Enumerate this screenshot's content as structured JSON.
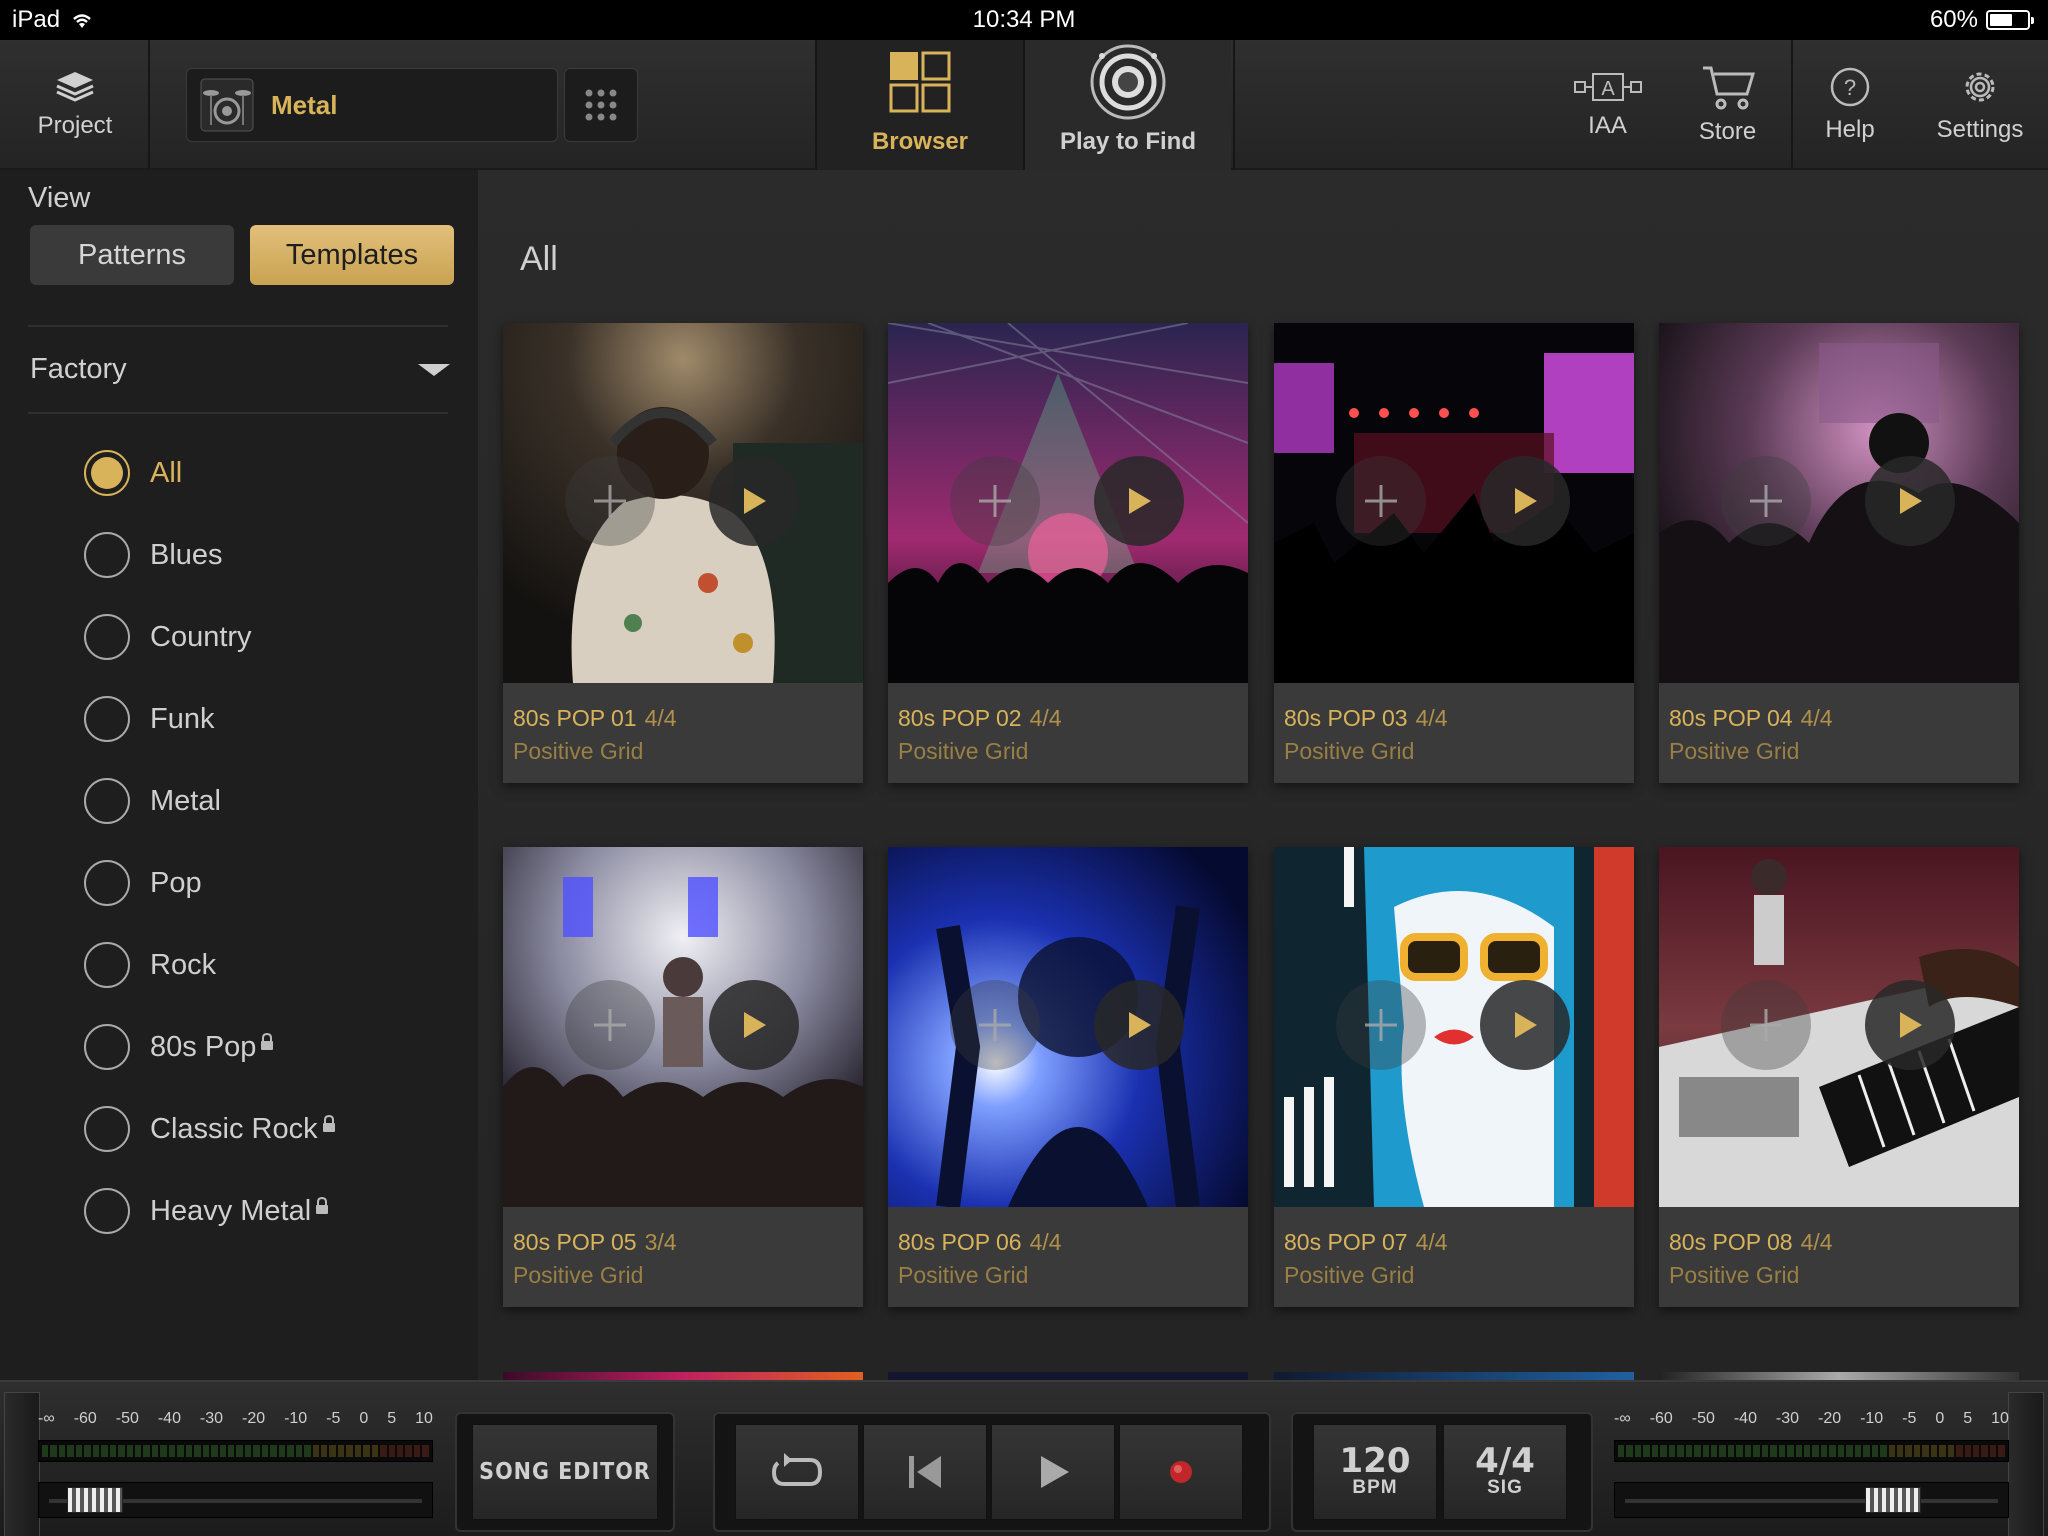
{
  "status": {
    "device": "iPad",
    "time": "10:34 PM",
    "battery": "60%",
    "battery_level": 0.6
  },
  "toolbar": {
    "project_label": "Project",
    "kit_name": "Metal",
    "browser_label": "Browser",
    "play_to_find_label": "Play to Find",
    "iaa_label": "IAA",
    "store_label": "Store",
    "help_label": "Help",
    "settings_label": "Settings"
  },
  "sidebar": {
    "view_label": "View",
    "patterns_label": "Patterns",
    "templates_label": "Templates",
    "factory_label": "Factory",
    "genres": [
      {
        "label": "All",
        "selected": true,
        "locked": false
      },
      {
        "label": "Blues",
        "selected": false,
        "locked": false
      },
      {
        "label": "Country",
        "selected": false,
        "locked": false
      },
      {
        "label": "Funk",
        "selected": false,
        "locked": false
      },
      {
        "label": "Metal",
        "selected": false,
        "locked": false
      },
      {
        "label": "Pop",
        "selected": false,
        "locked": false
      },
      {
        "label": "Rock",
        "selected": false,
        "locked": false
      },
      {
        "label": "80s Pop",
        "selected": false,
        "locked": true
      },
      {
        "label": "Classic Rock",
        "selected": false,
        "locked": true
      },
      {
        "label": "Heavy Metal",
        "selected": false,
        "locked": true
      }
    ]
  },
  "main": {
    "title": "All",
    "cards": [
      {
        "title": "80s POP 01",
        "sig": "4/4",
        "author": "Positive Grid"
      },
      {
        "title": "80s POP 02",
        "sig": "4/4",
        "author": "Positive Grid"
      },
      {
        "title": "80s POP 03",
        "sig": "4/4",
        "author": "Positive Grid"
      },
      {
        "title": "80s POP 04",
        "sig": "4/4",
        "author": "Positive Grid"
      },
      {
        "title": "80s POP 05",
        "sig": "3/4",
        "author": "Positive Grid"
      },
      {
        "title": "80s POP 06",
        "sig": "4/4",
        "author": "Positive Grid"
      },
      {
        "title": "80s POP 07",
        "sig": "4/4",
        "author": "Positive Grid"
      },
      {
        "title": "80s POP 08",
        "sig": "4/4",
        "author": "Positive Grid"
      }
    ]
  },
  "bottom": {
    "meter_scale": [
      "-∞",
      "-60",
      "-50",
      "-40",
      "-30",
      "-20",
      "-10",
      "-5",
      "0",
      "5",
      "10"
    ],
    "song_editor_label": "SONG EDITOR",
    "bpm_value": "120",
    "bpm_label": "BPM",
    "sig_value": "4/4",
    "sig_label": "SIG"
  },
  "colors": {
    "accent": "#d8b35a",
    "background": "#242424",
    "record": "#c0262a"
  }
}
